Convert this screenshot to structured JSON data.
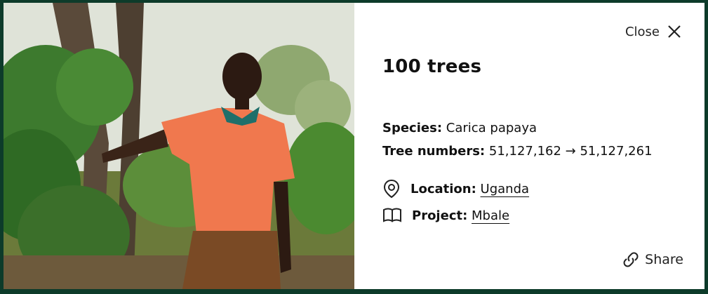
{
  "close_label": "Close",
  "title": "100 trees",
  "species": {
    "label": "Species:",
    "value": "Carica papaya"
  },
  "tree_numbers": {
    "label": "Tree numbers:",
    "value": "51,127,162 → 51,127,261"
  },
  "location": {
    "label": "Location:",
    "value": "Uganda"
  },
  "project": {
    "label": "Project:",
    "value": "Mbale"
  },
  "share_label": "Share",
  "icons": [
    "close-icon",
    "location-pin-icon",
    "book-icon",
    "link-icon"
  ],
  "colors": {
    "frame": "#0d3b2a",
    "panel": "#ffffff",
    "text": "#111111"
  }
}
